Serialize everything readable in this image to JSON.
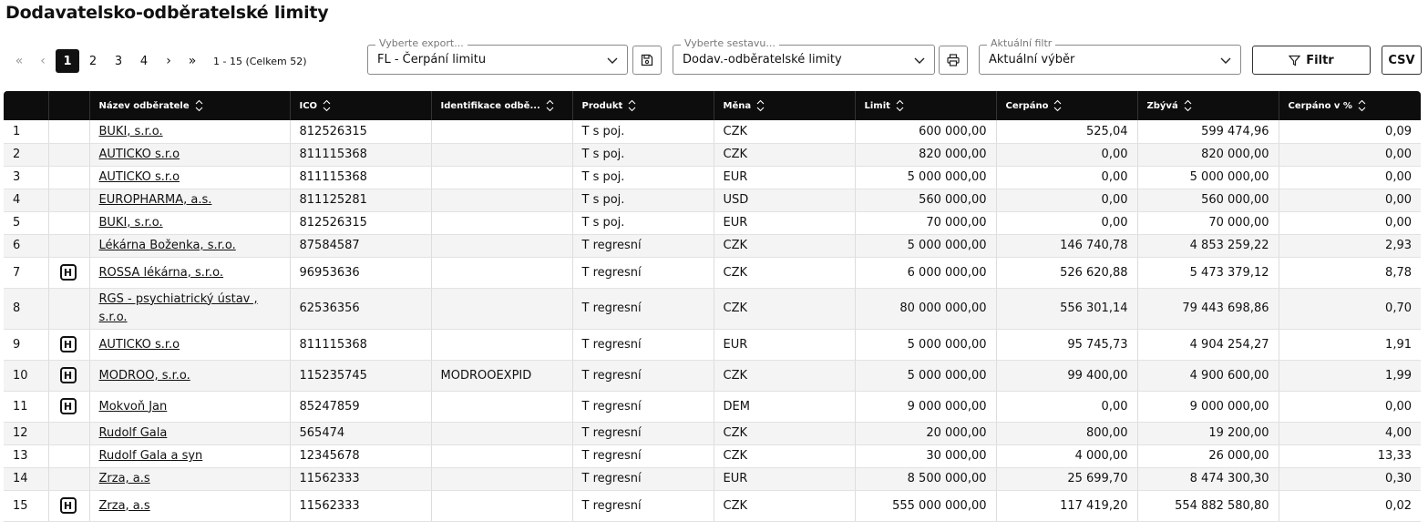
{
  "page": {
    "title": "Dodavatelsko-odběratelské limity"
  },
  "pager": {
    "first_icon": "double-chevron-left-icon",
    "prev_icon": "chevron-left-icon",
    "pages": [
      "1",
      "2",
      "3",
      "4"
    ],
    "active_page": "1",
    "next_icon": "chevron-right-icon",
    "last_icon": "double-chevron-right-icon",
    "info": "1 - 15 (Celkem 52)"
  },
  "export": {
    "legend": "Vyberte export...",
    "value": "FL - Čerpání limitu",
    "save_icon": "save-icon"
  },
  "report": {
    "legend": "Vyberte sestavu...",
    "value": "Dodav.-odběratelské limity",
    "print_icon": "print-icon"
  },
  "current_filter": {
    "legend": "Aktuální filtr",
    "value": "Aktuální výběr"
  },
  "buttons": {
    "filter": "Filtr",
    "csv": "CSV"
  },
  "table": {
    "headers": [
      "",
      "",
      "Název odběratele",
      "IČO",
      "Identifikace odbě...",
      "Produkt",
      "Měna",
      "Limit",
      "Čerpáno",
      "Zbývá",
      "Čerpáno v %"
    ],
    "badge_label": "H",
    "rows": [
      {
        "n": "1",
        "badge": false,
        "name": "BUKI, s.r.o.",
        "ico": "812526315",
        "ident": "",
        "product": "T s poj.",
        "currency": "CZK",
        "limit": "600 000,00",
        "drawn": "525,04",
        "left": "599 474,96",
        "pct": "0,09"
      },
      {
        "n": "2",
        "badge": false,
        "name": "AUTICKO s.r.o",
        "ico": "811115368",
        "ident": "",
        "product": "T s poj.",
        "currency": "CZK",
        "limit": "820 000,00",
        "drawn": "0,00",
        "left": "820 000,00",
        "pct": "0,00"
      },
      {
        "n": "3",
        "badge": false,
        "name": "AUTICKO s.r.o",
        "ico": "811115368",
        "ident": "",
        "product": "T s poj.",
        "currency": "EUR",
        "limit": "5 000 000,00",
        "drawn": "0,00",
        "left": "5 000 000,00",
        "pct": "0,00"
      },
      {
        "n": "4",
        "badge": false,
        "name": "EUROPHARMA, a.s.",
        "ico": "811125281",
        "ident": "",
        "product": "T s poj.",
        "currency": "USD",
        "limit": "560 000,00",
        "drawn": "0,00",
        "left": "560 000,00",
        "pct": "0,00"
      },
      {
        "n": "5",
        "badge": false,
        "name": "BUKI, s.r.o.",
        "ico": "812526315",
        "ident": "",
        "product": "T s poj.",
        "currency": "EUR",
        "limit": "70 000,00",
        "drawn": "0,00",
        "left": "70 000,00",
        "pct": "0,00"
      },
      {
        "n": "6",
        "badge": false,
        "name": "Lékárna Boženka, s.r.o.",
        "ico": "87584587",
        "ident": "",
        "product": "T regresní",
        "currency": "CZK",
        "limit": "5 000 000,00",
        "drawn": "146 740,78",
        "left": "4 853 259,22",
        "pct": "2,93"
      },
      {
        "n": "7",
        "badge": true,
        "name": "ROSSA lékárna, s.r.o.",
        "ico": "96953636",
        "ident": "",
        "product": "T regresní",
        "currency": "CZK",
        "limit": "6 000 000,00",
        "drawn": "526 620,88",
        "left": "5 473 379,12",
        "pct": "8,78"
      },
      {
        "n": "8",
        "badge": false,
        "name": "RGS - psychiatrický ústav , s.r.o.",
        "ico": "62536356",
        "ident": "",
        "product": "T regresní",
        "currency": "CZK",
        "limit": "80 000 000,00",
        "drawn": "556 301,14",
        "left": "79 443 698,86",
        "pct": "0,70"
      },
      {
        "n": "9",
        "badge": true,
        "name": "AUTICKO s.r.o",
        "ico": "811115368",
        "ident": "",
        "product": "T regresní",
        "currency": "EUR",
        "limit": "5 000 000,00",
        "drawn": "95 745,73",
        "left": "4 904 254,27",
        "pct": "1,91"
      },
      {
        "n": "10",
        "badge": true,
        "name": "MODROO, s.r.o.",
        "ico": "115235745",
        "ident": "MODROOEXPID",
        "product": "T regresní",
        "currency": "CZK",
        "limit": "5 000 000,00",
        "drawn": "99 400,00",
        "left": "4 900 600,00",
        "pct": "1,99"
      },
      {
        "n": "11",
        "badge": true,
        "name": "Mokvoň Jan",
        "ico": "85247859",
        "ident": "",
        "product": "T regresní",
        "currency": "DEM",
        "limit": "9 000 000,00",
        "drawn": "0,00",
        "left": "9 000 000,00",
        "pct": "0,00"
      },
      {
        "n": "12",
        "badge": false,
        "name": "Rudolf Gala",
        "ico": "565474",
        "ident": "",
        "product": "T regresní",
        "currency": "CZK",
        "limit": "20 000,00",
        "drawn": "800,00",
        "left": "19 200,00",
        "pct": "4,00"
      },
      {
        "n": "13",
        "badge": false,
        "name": "Rudolf Gala a syn",
        "ico": "12345678",
        "ident": "",
        "product": "T regresní",
        "currency": "CZK",
        "limit": "30 000,00",
        "drawn": "4 000,00",
        "left": "26 000,00",
        "pct": "13,33"
      },
      {
        "n": "14",
        "badge": false,
        "name": "Zrza, a.s",
        "ico": "11562333",
        "ident": "",
        "product": "T regresní",
        "currency": "EUR",
        "limit": "8 500 000,00",
        "drawn": "25 699,70",
        "left": "8 474 300,30",
        "pct": "0,30"
      },
      {
        "n": "15",
        "badge": true,
        "name": "Zrza, a.s",
        "ico": "11562333",
        "ident": "",
        "product": "T regresní",
        "currency": "CZK",
        "limit": "555 000 000,00",
        "drawn": "117 419,20",
        "left": "554 882 580,80",
        "pct": "0,02"
      }
    ]
  }
}
